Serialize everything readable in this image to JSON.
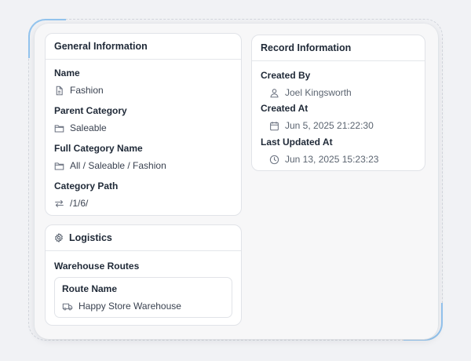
{
  "general_information": {
    "title": "General Information",
    "fields": [
      {
        "label": "Name",
        "value": "Fashion",
        "icon": "file-icon"
      },
      {
        "label": "Parent Category",
        "value": "Saleable",
        "icon": "folder-icon"
      },
      {
        "label": "Full Category Name",
        "value": "All / Saleable / Fashion",
        "icon": "folder-icon"
      },
      {
        "label": "Category Path",
        "value": "/1/6/",
        "icon": "swap-arrows-icon"
      }
    ]
  },
  "record_information": {
    "title": "Record Information",
    "fields": [
      {
        "label": "Created By",
        "value": "Joel Kingsworth",
        "icon": "user-icon"
      },
      {
        "label": "Created At",
        "value": "Jun 5, 2025 21:22:30",
        "icon": "calendar-icon"
      },
      {
        "label": "Last Updated At",
        "value": "Jun 13, 2025 15:23:23",
        "icon": "clock-icon"
      }
    ]
  },
  "logistics": {
    "title": "Logistics",
    "icon": "gear-icon",
    "section_label": "Warehouse Routes",
    "route": {
      "label": "Route Name",
      "value": "Happy Store Warehouse",
      "icon": "truck-icon"
    }
  },
  "colors": {
    "accent": "#93c4ee",
    "text": "#1f2937",
    "muted": "#5b6470",
    "border": "#e1e3e8"
  }
}
